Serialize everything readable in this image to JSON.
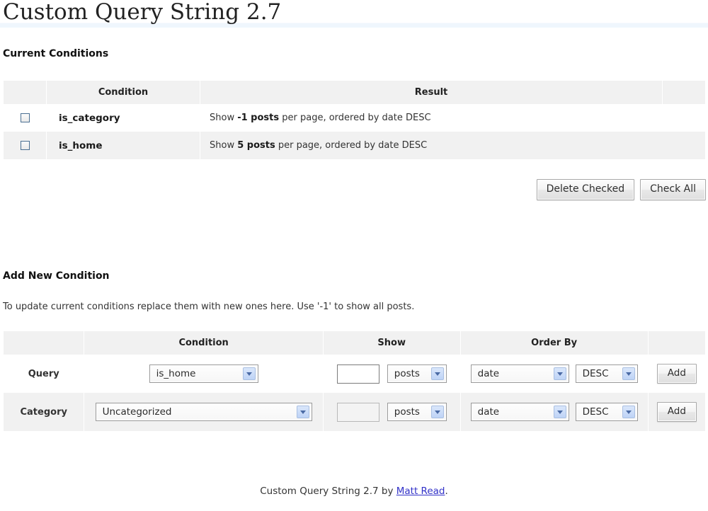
{
  "page": {
    "title": "Custom Query String 2.7"
  },
  "current_conditions": {
    "heading": "Current Conditions",
    "columns": {
      "checkbox": "",
      "condition": "Condition",
      "result": "Result",
      "spacer": ""
    },
    "rows": [
      {
        "condition": "is_category",
        "result_prefix": "Show ",
        "result_bold": "-1 posts",
        "result_suffix": " per page, ordered by date DESC"
      },
      {
        "condition": "is_home",
        "result_prefix": "Show ",
        "result_bold": "5 posts",
        "result_suffix": " per page, ordered by date DESC"
      }
    ],
    "buttons": {
      "delete_checked": "Delete Checked",
      "check_all": "Check All"
    }
  },
  "add_new_condition": {
    "heading": "Add New Condition",
    "instructions": "To update current conditions replace them with new ones here. Use '-1' to show all posts.",
    "columns": {
      "label": "",
      "condition": "Condition",
      "show": "Show",
      "order_by": "Order By",
      "action": ""
    },
    "rows": [
      {
        "label": "Query",
        "condition_value": "is_home",
        "show_value": "",
        "show_placeholder": "",
        "unit_value": "posts",
        "orderby_value": "date",
        "direction_value": "DESC",
        "add_label": "Add",
        "show_disabled": false
      },
      {
        "label": "Category",
        "condition_value": "Uncategorized",
        "show_value": "",
        "show_placeholder": "",
        "unit_value": "posts",
        "orderby_value": "date",
        "direction_value": "DESC",
        "add_label": "Add",
        "show_disabled": true
      }
    ]
  },
  "footer": {
    "prefix": "Custom Query String 2.7 by ",
    "link": "Matt Read",
    "suffix": "."
  }
}
